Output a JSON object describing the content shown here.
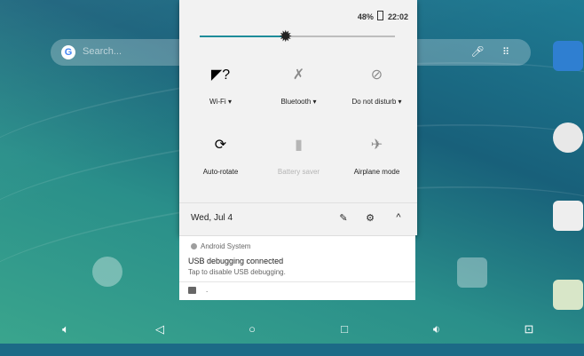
{
  "status_bar": {
    "battery": "48%",
    "time": "22:02"
  },
  "search": {
    "placeholder": "Search..."
  },
  "quick_settings": {
    "brightness_level": 0.44,
    "tiles_row1": [
      {
        "label": "Wi-Fi",
        "dropdown": "▾",
        "icon": "wifi-question-icon"
      },
      {
        "label": "Bluetooth",
        "dropdown": "▾",
        "icon": "bluetooth-off-icon"
      },
      {
        "label": "Do not disturb",
        "dropdown": "▾",
        "icon": "do-not-disturb-icon"
      }
    ],
    "tiles_row2": [
      {
        "label": "Auto-rotate",
        "icon": "auto-rotate-icon"
      },
      {
        "label": "Battery saver",
        "icon": "battery-saver-icon"
      },
      {
        "label": "Airplane mode",
        "icon": "airplane-mode-icon"
      }
    ],
    "date": "Wed, Jul 4"
  },
  "notification": {
    "app": "Android System",
    "title": "USB debugging connected",
    "body": "Tap to disable USB debugging."
  },
  "notification2": {
    "text": "."
  },
  "colors": {
    "accent": "#1e8c9a",
    "shade_bg": "#f2f2f2"
  }
}
